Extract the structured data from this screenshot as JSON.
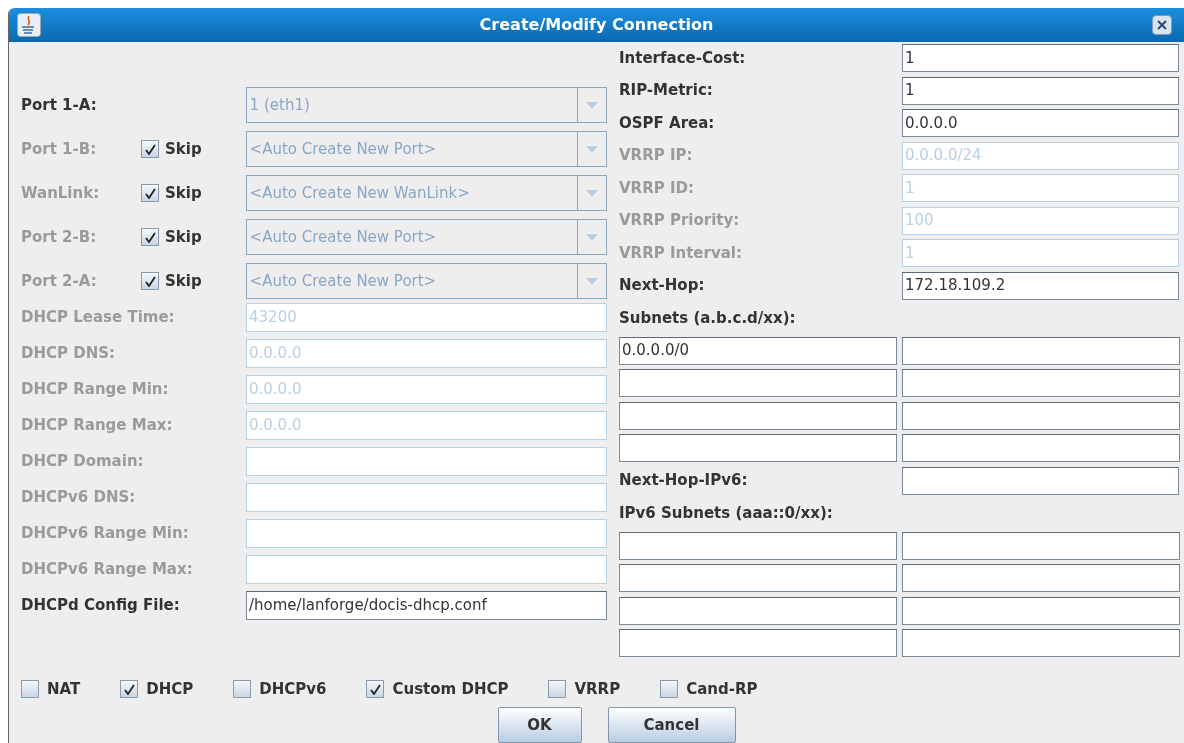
{
  "window": {
    "title": "Create/Modify Connection"
  },
  "ports": [
    {
      "label": "Port 1-A:",
      "disabled": false,
      "value": "1 (eth1)"
    },
    {
      "label": "Port 1-B:",
      "disabled": true,
      "skip": {
        "label": "Skip",
        "checked": true
      },
      "value": "<Auto Create New Port>"
    },
    {
      "label": "WanLink:",
      "disabled": true,
      "skip": {
        "label": "Skip",
        "checked": true
      },
      "value": "<Auto Create New WanLink>"
    },
    {
      "label": "Port 2-B:",
      "disabled": true,
      "skip": {
        "label": "Skip",
        "checked": true
      },
      "value": "<Auto Create New Port>"
    },
    {
      "label": "Port 2-A:",
      "disabled": true,
      "skip": {
        "label": "Skip",
        "checked": true
      },
      "value": "<Auto Create New Port>"
    }
  ],
  "dhcp_fields": [
    {
      "label": "DHCP Lease Time:",
      "value": "43200",
      "disabled": true
    },
    {
      "label": "DHCP DNS:",
      "value": "0.0.0.0",
      "disabled": true
    },
    {
      "label": "DHCP Range Min:",
      "value": "0.0.0.0",
      "disabled": true
    },
    {
      "label": "DHCP Range Max:",
      "value": "0.0.0.0",
      "disabled": true
    },
    {
      "label": "DHCP Domain:",
      "disabled": true
    },
    {
      "label": "DHCPv6 DNS:",
      "disabled": true
    },
    {
      "label": "DHCPv6 Range Min:",
      "disabled": true
    },
    {
      "label": "DHCPv6 Range Max:",
      "disabled": true
    },
    {
      "label": "DHCPd Config File:",
      "value": "/home/lanforge/docis-dhcp.conf",
      "disabled": false
    }
  ],
  "routing_fields": [
    {
      "label": "Interface-Cost:",
      "value": "1",
      "disabled": false
    },
    {
      "label": "RIP-Metric:",
      "value": "1",
      "disabled": false
    },
    {
      "label": "OSPF Area:",
      "value": "0.0.0.0",
      "disabled": false
    },
    {
      "label": "VRRP IP:",
      "value": "0.0.0.0/24",
      "disabled": true
    },
    {
      "label": "VRRP ID:",
      "value": "1",
      "disabled": true
    },
    {
      "label": "VRRP Priority:",
      "value": "100",
      "disabled": true
    },
    {
      "label": "VRRP Interval:",
      "value": "1",
      "disabled": true
    },
    {
      "label": "Next-Hop:",
      "value": "172.18.109.2",
      "disabled": false
    }
  ],
  "subnets": {
    "label": "Subnets (a.b.c.d/xx):",
    "fields": [
      {
        "kind": "input",
        "value": "0.0.0.0/0"
      },
      {
        "kind": "input"
      },
      {
        "kind": "input"
      },
      {
        "kind": "input"
      },
      {
        "kind": "input"
      },
      {
        "kind": "input"
      },
      {
        "kind": "input"
      },
      {
        "kind": "input"
      }
    ]
  },
  "next_hop_ipv6": {
    "label": "Next-Hop-IPv6:",
    "disabled": false
  },
  "ipv6_subnets": {
    "label": "IPv6 Subnets (aaa::0/xx):",
    "fields": [
      {
        "kind": "input"
      },
      {
        "kind": "input"
      },
      {
        "kind": "input"
      },
      {
        "kind": "input"
      },
      {
        "kind": "input"
      },
      {
        "kind": "input"
      },
      {
        "kind": "input"
      },
      {
        "kind": "input"
      }
    ]
  },
  "options": [
    {
      "label": "NAT",
      "checked": false
    },
    {
      "label": "DHCP",
      "checked": true
    },
    {
      "label": "DHCPv6",
      "checked": false
    },
    {
      "label": "Custom DHCP",
      "checked": true
    },
    {
      "label": "VRRP",
      "checked": false
    },
    {
      "label": "Cand-RP",
      "checked": false
    }
  ],
  "buttons": [
    "OK",
    "Cancel"
  ]
}
